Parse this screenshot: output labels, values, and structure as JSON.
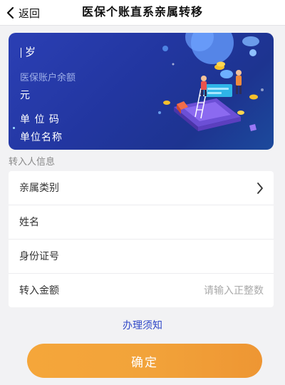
{
  "navbar": {
    "back_label": "返回",
    "title": "医保个账直系亲属转移"
  },
  "card": {
    "age_suffix": "岁",
    "balance_label": "医保账户余额",
    "balance_unit": "元",
    "unit_code_label": "单 位 码",
    "unit_name_label": "单位名称"
  },
  "section": {
    "title": "转入人信息"
  },
  "form": {
    "relation_label": "亲属类别",
    "name_label": "姓名",
    "id_label": "身份证号",
    "amount_label": "转入金额",
    "amount_placeholder": "请输入正整数"
  },
  "notice_link": "办理须知",
  "confirm_label": "确定",
  "icons": {
    "back": "chevron-left-icon",
    "relation_arrow": "chevron-right-icon"
  },
  "colors": {
    "card_bg": "#2236a0",
    "link": "#2f47c7",
    "button": "#f2a33a"
  }
}
